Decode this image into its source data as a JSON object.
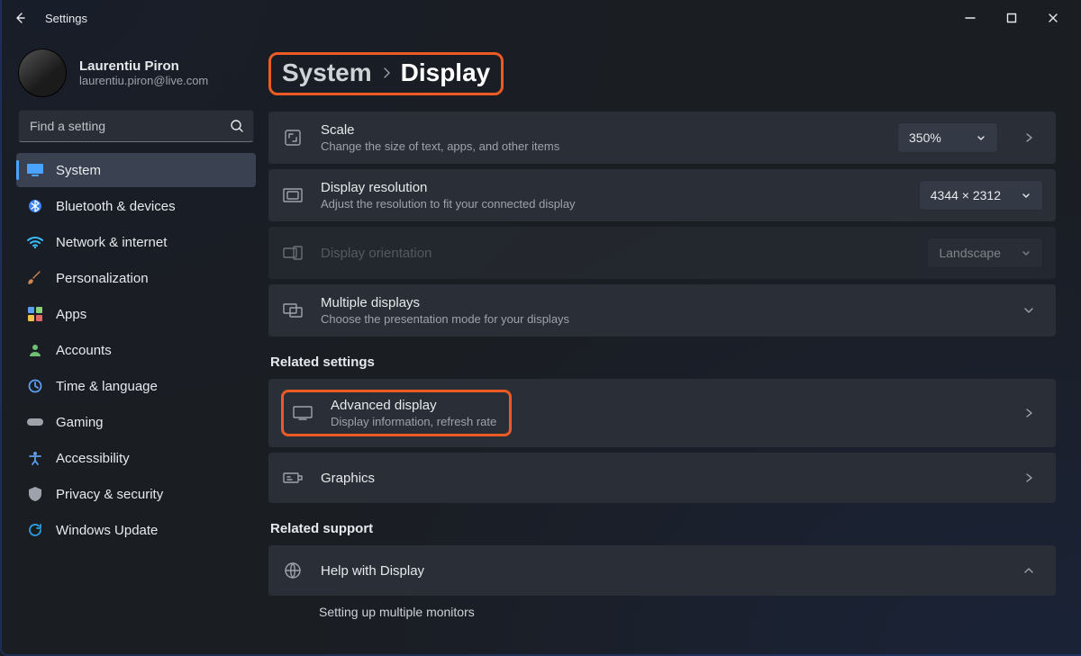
{
  "app": {
    "title": "Settings"
  },
  "account": {
    "name": "Laurentiu Piron",
    "email": "laurentiu.piron@live.com"
  },
  "search": {
    "placeholder": "Find a setting"
  },
  "sidebar": {
    "items": [
      {
        "label": "System",
        "icon": "monitor-icon",
        "active": true
      },
      {
        "label": "Bluetooth & devices",
        "icon": "bluetooth-icon",
        "active": false
      },
      {
        "label": "Network & internet",
        "icon": "wifi-icon",
        "active": false
      },
      {
        "label": "Personalization",
        "icon": "brush-icon",
        "active": false
      },
      {
        "label": "Apps",
        "icon": "apps-icon",
        "active": false
      },
      {
        "label": "Accounts",
        "icon": "person-icon",
        "active": false
      },
      {
        "label": "Time & language",
        "icon": "clock-icon",
        "active": false
      },
      {
        "label": "Gaming",
        "icon": "gamepad-icon",
        "active": false
      },
      {
        "label": "Accessibility",
        "icon": "accessibility-icon",
        "active": false
      },
      {
        "label": "Privacy & security",
        "icon": "shield-icon",
        "active": false
      },
      {
        "label": "Windows Update",
        "icon": "update-icon",
        "active": false
      }
    ]
  },
  "breadcrumb": {
    "parent": "System",
    "current": "Display"
  },
  "settings": {
    "scale": {
      "title": "Scale",
      "desc": "Change the size of text, apps, and other items",
      "value": "350%"
    },
    "resolution": {
      "title": "Display resolution",
      "desc": "Adjust the resolution to fit your connected display",
      "value": "4344 × 2312"
    },
    "orientation": {
      "title": "Display orientation",
      "value": "Landscape"
    },
    "multi": {
      "title": "Multiple displays",
      "desc": "Choose the presentation mode for your displays"
    }
  },
  "sections": {
    "related_settings": "Related settings",
    "related_support": "Related support"
  },
  "related": {
    "advanced": {
      "title": "Advanced display",
      "desc": "Display information, refresh rate"
    },
    "graphics": {
      "title": "Graphics"
    }
  },
  "support": {
    "help": {
      "title": "Help with Display"
    },
    "setup": {
      "title": "Setting up multiple monitors"
    }
  },
  "highlight_color": "#ee5a24"
}
